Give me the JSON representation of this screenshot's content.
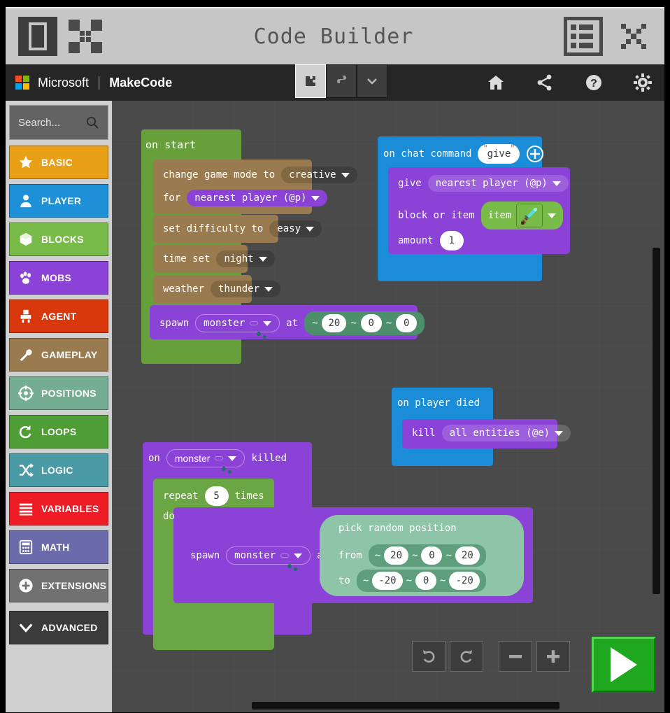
{
  "titlebar": {
    "title": "Code Builder",
    "icons": {
      "panel": "panel-toggle-icon",
      "expand": "expand-fullscreen-icon",
      "list": "list-menu-icon",
      "close": "close-icon"
    }
  },
  "header": {
    "brand_microsoft": "Microsoft",
    "brand_separator": "|",
    "brand_makecode": "MakeCode",
    "mode_buttons": [
      {
        "name": "blocks-mode-button",
        "icon": "puzzle-piece-icon",
        "active": true
      },
      {
        "name": "python-mode-button",
        "icon": "python-icon",
        "active": false
      },
      {
        "name": "mode-dropdown-button",
        "icon": "chevron-down-icon",
        "active": false
      }
    ],
    "actions": [
      {
        "name": "home-button",
        "icon": "home-icon"
      },
      {
        "name": "share-button",
        "icon": "share-icon"
      },
      {
        "name": "help-button",
        "icon": "question-help-icon"
      },
      {
        "name": "settings-button",
        "icon": "gear-icon"
      }
    ]
  },
  "toolbox": {
    "search": {
      "placeholder": "Search...",
      "value": "",
      "icon": "search-icon"
    },
    "categories": [
      {
        "label": "BASIC",
        "color": "#e8a117",
        "icon": "star-icon"
      },
      {
        "label": "PLAYER",
        "color": "#1e90d8",
        "icon": "person-icon"
      },
      {
        "label": "BLOCKS",
        "color": "#79bb48",
        "icon": "cube-icon"
      },
      {
        "label": "MOBS",
        "color": "#8b42d6",
        "icon": "paw-icon"
      },
      {
        "label": "AGENT",
        "color": "#d9380d",
        "icon": "robot-icon"
      },
      {
        "label": "GAMEPLAY",
        "color": "#9a7b4f",
        "icon": "wrench-icon"
      },
      {
        "label": "POSITIONS",
        "color": "#74ad92",
        "icon": "crosshair-icon"
      },
      {
        "label": "LOOPS",
        "color": "#4f9e35",
        "icon": "loop-arrow-icon"
      },
      {
        "label": "LOGIC",
        "color": "#4a9ba5",
        "icon": "shuffle-icon"
      },
      {
        "label": "VARIABLES",
        "color": "#ee1c25",
        "icon": "lines-icon"
      },
      {
        "label": "MATH",
        "color": "#6b6bab",
        "icon": "calculator-icon"
      },
      {
        "label": "EXTENSIONS",
        "color": "#717171",
        "icon": "plus-circle-icon"
      },
      {
        "label": "ADVANCED",
        "color": "#3b3b3b",
        "icon": "chevron-down-icon"
      }
    ]
  },
  "workspace": {
    "on_start": {
      "hat_label": "on start",
      "change_game_mode": {
        "text_1": "change game mode to",
        "mode": "creative",
        "text_2": "for",
        "target": "nearest player (@p)"
      },
      "set_difficulty": {
        "text": "set difficulty to",
        "value": "easy"
      },
      "time_set": {
        "text": "time set",
        "value": "night"
      },
      "weather": {
        "text": "weather",
        "value": "thunder"
      },
      "spawn": {
        "text_1": "spawn",
        "mob_label": "monster",
        "mob_icon": "spawn-egg-icon",
        "text_2": "at",
        "coords": [
          {
            "tilde": "~",
            "value": "20"
          },
          {
            "tilde": "~",
            "value": "0"
          },
          {
            "tilde": "~",
            "value": "0"
          }
        ]
      }
    },
    "on_chat_command": {
      "hat_label": "on chat command",
      "command": "give",
      "quote": "\"",
      "add_icon": "plus-circle-icon",
      "give": {
        "text": "give",
        "target": "nearest player (@p)"
      },
      "block_or_item": {
        "text": "block or item",
        "label": "item",
        "icon": "diamond-sword-icon"
      },
      "amount": {
        "text": "amount",
        "value": "1"
      }
    },
    "on_player_died": {
      "hat_label": "on player died",
      "kill": {
        "text": "kill",
        "target": "all entities (@e)"
      }
    },
    "on_monster_killed": {
      "hat_text_1": "on",
      "hat_mob_label": "monster",
      "hat_mob_icon": "spawn-egg-icon",
      "hat_text_2": "killed",
      "repeat": {
        "text_1": "repeat",
        "value": "5",
        "text_2": "times",
        "text_do": "do"
      },
      "spawn": {
        "text_1": "spawn",
        "mob_label": "monster",
        "mob_icon": "spawn-egg-icon",
        "text_2": "at"
      },
      "pick_random_position": {
        "title": "pick random position",
        "from_label": "from",
        "from": [
          {
            "tilde": "~",
            "value": "20"
          },
          {
            "tilde": "~",
            "value": "0"
          },
          {
            "tilde": "~",
            "value": "20"
          }
        ],
        "to_label": "to",
        "to": [
          {
            "tilde": "~",
            "value": "-20"
          },
          {
            "tilde": "~",
            "value": "0"
          },
          {
            "tilde": "~",
            "value": "-20"
          }
        ]
      }
    },
    "controls": [
      {
        "name": "undo-button",
        "icon": "undo-icon"
      },
      {
        "name": "redo-button",
        "icon": "redo-icon"
      },
      {
        "name": "zoom-out-button",
        "icon": "minus-icon"
      },
      {
        "name": "zoom-in-button",
        "icon": "plus-icon"
      }
    ],
    "play_button": {
      "name": "play-button",
      "icon": "play-triangle-icon"
    }
  },
  "colors": {
    "event_blue": "#1a8cd8",
    "mobs_purple": "#8b42d6",
    "gameplay_brown": "#9a7b4f",
    "loops_green": "#6aa644",
    "basic_green": "#67a03a",
    "positions_green": "#74ad92",
    "blocks_green": "#79bb48",
    "workspace_bg": "#4a4a4a",
    "titlebar_bg": "#c6c6c6",
    "header_bg": "#262626"
  }
}
